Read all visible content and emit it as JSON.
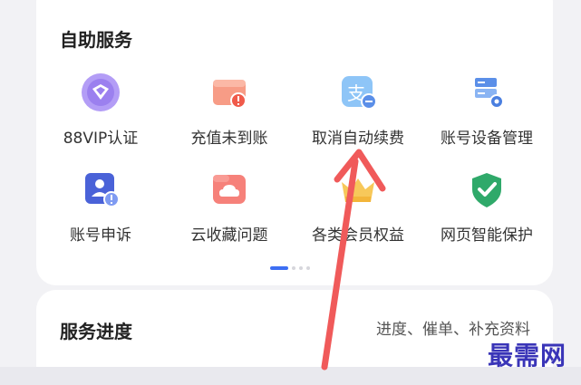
{
  "self_service": {
    "title": "自助服务",
    "items": [
      {
        "label": "88VIP认证",
        "icon": "vip-diamond-icon"
      },
      {
        "label": "充值未到账",
        "icon": "recharge-wallet-icon"
      },
      {
        "label": "取消自动续费",
        "icon": "alipay-cancel-icon"
      },
      {
        "label": "账号设备管理",
        "icon": "device-server-icon"
      },
      {
        "label": "账号申诉",
        "icon": "account-appeal-icon"
      },
      {
        "label": "云收藏问题",
        "icon": "cloud-folder-icon"
      },
      {
        "label": "各类会员权益",
        "icon": "member-crown-icon"
      },
      {
        "label": "网页智能保护",
        "icon": "shield-check-icon"
      }
    ],
    "pager": {
      "active": 1,
      "total": 4
    }
  },
  "service_progress": {
    "title": "服务进度",
    "hint": "进度、催单、补充资料"
  },
  "watermark": "最需网",
  "colors": {
    "accent": "#3d6ff3",
    "arrow": "#f05a5a",
    "watermark": "#3a35b8"
  }
}
